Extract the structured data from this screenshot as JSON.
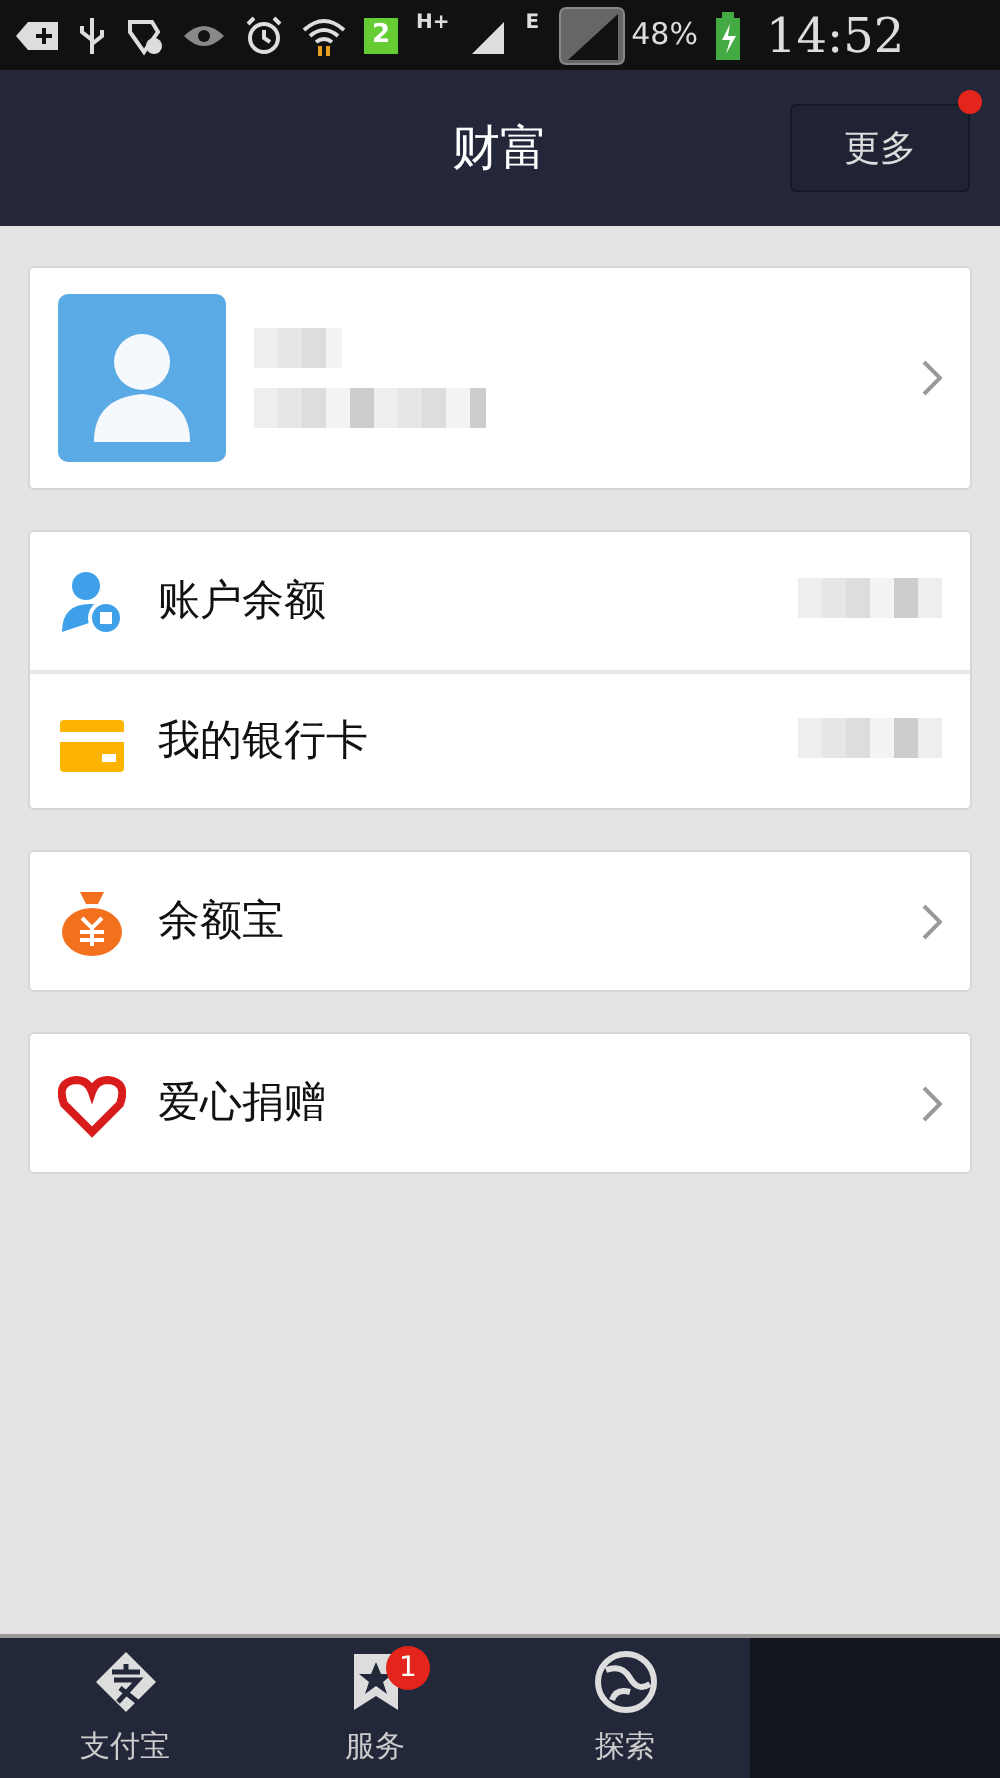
{
  "status_bar": {
    "sim_slot": "2",
    "network_type_1": "H+",
    "network_type_2": "E",
    "battery": "48%",
    "time": "14:52"
  },
  "header": {
    "title": "财富",
    "more_button": {
      "label": "更多",
      "has_notification": true
    }
  },
  "profile": {
    "kind": "profile"
  },
  "groups": [
    {
      "items": [
        {
          "kind": "balance",
          "label": "账户余额",
          "trailing": {
            "kind": "redacted"
          }
        },
        {
          "kind": "bank_card",
          "label": "我的银行卡",
          "trailing": {
            "kind": "redacted"
          }
        }
      ]
    },
    {
      "items": [
        {
          "kind": "yuebao",
          "label": "余额宝",
          "trailing": {
            "kind": "chevron"
          }
        }
      ]
    },
    {
      "items": [
        {
          "kind": "charity",
          "label": "爱心捐赠",
          "trailing": {
            "kind": "chevron"
          }
        }
      ]
    }
  ],
  "tabs": [
    {
      "kind": "alipay",
      "label": "支付宝",
      "selected": false
    },
    {
      "kind": "service",
      "label": "服务",
      "badge": "1",
      "selected": false
    },
    {
      "kind": "explore",
      "label": "探索",
      "selected": false
    },
    {
      "kind": "hidden",
      "selected": true
    }
  ]
}
